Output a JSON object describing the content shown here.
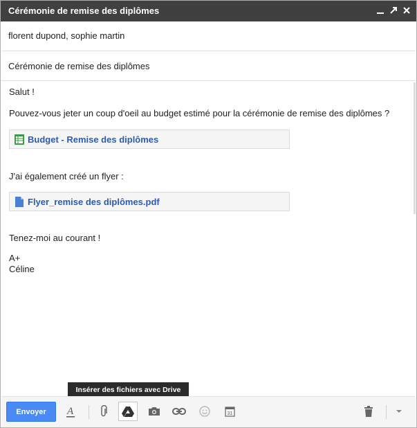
{
  "window": {
    "title": "Cérémonie de remise des diplômes",
    "icons": [
      "minimize-icon",
      "popout-icon",
      "close-icon"
    ]
  },
  "compose": {
    "to": "florent dupond, sophie martin",
    "subject": "Cérémonie de remise des diplômes",
    "body": {
      "greeting": "Salut !",
      "line1": "Pouvez-vous jeter un coup d'oeil au budget estimé pour la cérémonie de remise des diplômes ?",
      "attachment1": "Budget - Remise des diplômes",
      "line2": "J'ai également créé un flyer :",
      "attachment2": "Flyer_remise des diplômes.pdf",
      "line3": "Tenez-moi au courant !",
      "signoff": "A+",
      "signature": "Céline"
    }
  },
  "toolbar": {
    "send_label": "Envoyer",
    "tooltip": "Insérer des fichiers avec Drive",
    "accent_color": "#4a8af4"
  }
}
